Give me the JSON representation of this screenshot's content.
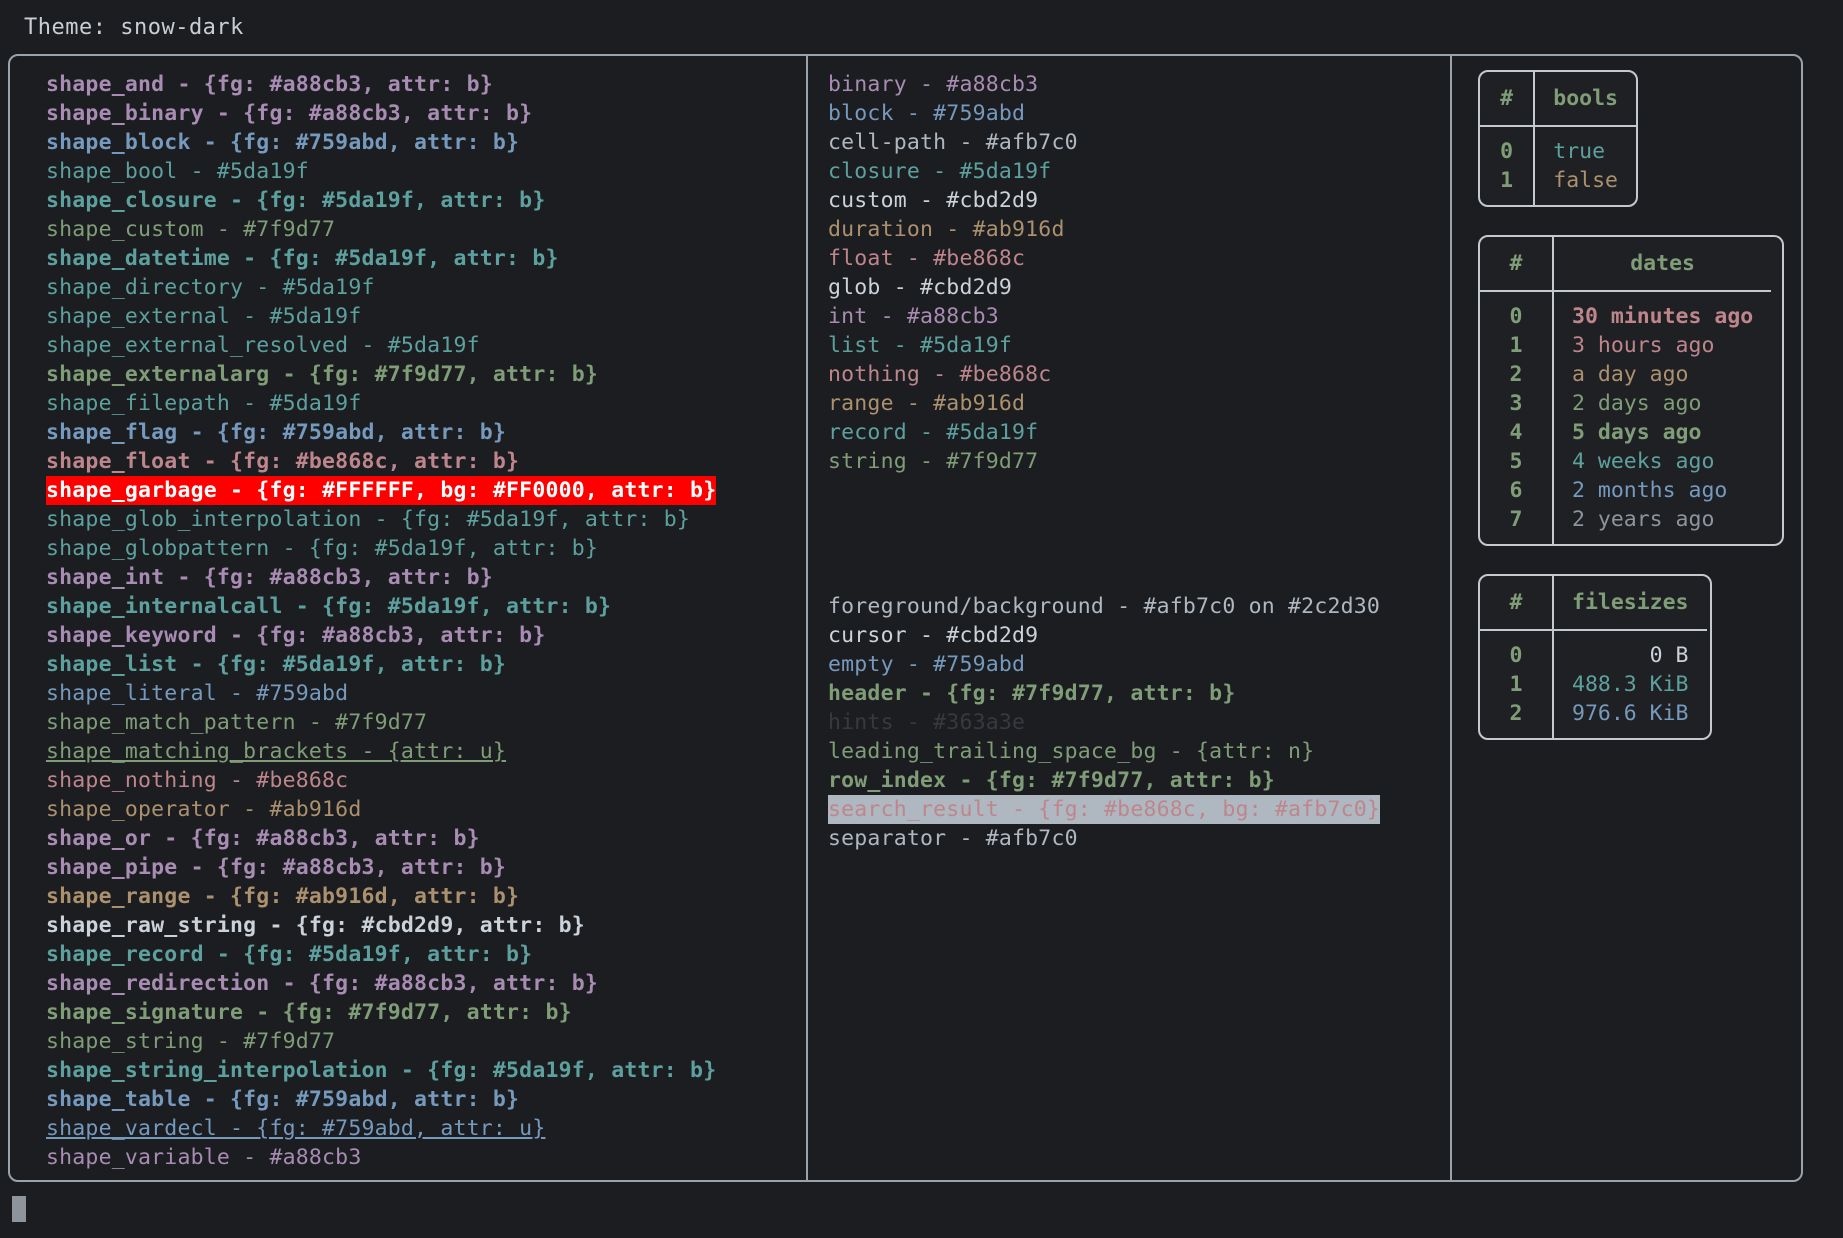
{
  "header": {
    "theme_label": "Theme: snow-dark"
  },
  "colors": {
    "purple": "#a88cb3",
    "blue": "#759abd",
    "teal": "#5da19f",
    "olive": "#7f9d77",
    "rose": "#be868c",
    "gold": "#ab916d",
    "white": "#cbd2d9",
    "grey": "#afb7c0",
    "dim": "#363a3e",
    "garbage_fg": "#FFFFFF",
    "garbage_bg": "#FF0000",
    "search_bg": "#afb7c0",
    "background": "#2c2d30"
  },
  "shapes_column": [
    {
      "text": "shape_and - {fg: #a88cb3, attr: b}",
      "color": "#a88cb3",
      "bold": true,
      "underline": false
    },
    {
      "text": "shape_binary - {fg: #a88cb3, attr: b}",
      "color": "#a88cb3",
      "bold": true,
      "underline": false
    },
    {
      "text": "shape_block - {fg: #759abd, attr: b}",
      "color": "#759abd",
      "bold": true,
      "underline": false
    },
    {
      "text": "shape_bool - #5da19f",
      "color": "#5da19f",
      "bold": false,
      "underline": false
    },
    {
      "text": "shape_closure - {fg: #5da19f, attr: b}",
      "color": "#5da19f",
      "bold": true,
      "underline": false
    },
    {
      "text": "shape_custom - #7f9d77",
      "color": "#7f9d77",
      "bold": false,
      "underline": false
    },
    {
      "text": "shape_datetime - {fg: #5da19f, attr: b}",
      "color": "#5da19f",
      "bold": true,
      "underline": false
    },
    {
      "text": "shape_directory - #5da19f",
      "color": "#5da19f",
      "bold": false,
      "underline": false
    },
    {
      "text": "shape_external - #5da19f",
      "color": "#5da19f",
      "bold": false,
      "underline": false
    },
    {
      "text": "shape_external_resolved - #5da19f",
      "color": "#5da19f",
      "bold": false,
      "underline": false
    },
    {
      "text": "shape_externalarg - {fg: #7f9d77, attr: b}",
      "color": "#7f9d77",
      "bold": true,
      "underline": false
    },
    {
      "text": "shape_filepath - #5da19f",
      "color": "#5da19f",
      "bold": false,
      "underline": false
    },
    {
      "text": "shape_flag - {fg: #759abd, attr: b}",
      "color": "#759abd",
      "bold": true,
      "underline": false
    },
    {
      "text": "shape_float - {fg: #be868c, attr: b}",
      "color": "#be868c",
      "bold": true,
      "underline": false
    },
    {
      "text": "shape_garbage - {fg: #FFFFFF, bg: #FF0000, attr: b}",
      "color": "#FFFFFF",
      "bg": "#FF0000",
      "bold": true,
      "underline": false
    },
    {
      "text": "shape_glob_interpolation - {fg: #5da19f, attr: b}",
      "color": "#5da19f",
      "bold": false,
      "underline": false
    },
    {
      "text": "shape_globpattern - {fg: #5da19f, attr: b}",
      "color": "#5da19f",
      "bold": false,
      "underline": false
    },
    {
      "text": "shape_int - {fg: #a88cb3, attr: b}",
      "color": "#a88cb3",
      "bold": true,
      "underline": false
    },
    {
      "text": "shape_internalcall - {fg: #5da19f, attr: b}",
      "color": "#5da19f",
      "bold": true,
      "underline": false
    },
    {
      "text": "shape_keyword - {fg: #a88cb3, attr: b}",
      "color": "#a88cb3",
      "bold": true,
      "underline": false
    },
    {
      "text": "shape_list - {fg: #5da19f, attr: b}",
      "color": "#5da19f",
      "bold": true,
      "underline": false
    },
    {
      "text": "shape_literal - #759abd",
      "color": "#759abd",
      "bold": false,
      "underline": false
    },
    {
      "text": "shape_match_pattern - #7f9d77",
      "color": "#7f9d77",
      "bold": false,
      "underline": false
    },
    {
      "text": "shape_matching_brackets - {attr: u}",
      "color": "#7f9d77",
      "bold": false,
      "underline": true
    },
    {
      "text": "shape_nothing - #be868c",
      "color": "#be868c",
      "bold": false,
      "underline": false
    },
    {
      "text": "shape_operator - #ab916d",
      "color": "#ab916d",
      "bold": false,
      "underline": false
    },
    {
      "text": "shape_or - {fg: #a88cb3, attr: b}",
      "color": "#a88cb3",
      "bold": true,
      "underline": false
    },
    {
      "text": "shape_pipe - {fg: #a88cb3, attr: b}",
      "color": "#a88cb3",
      "bold": true,
      "underline": false
    },
    {
      "text": "shape_range - {fg: #ab916d, attr: b}",
      "color": "#ab916d",
      "bold": true,
      "underline": false
    },
    {
      "text": "shape_raw_string - {fg: #cbd2d9, attr: b}",
      "color": "#cbd2d9",
      "bold": true,
      "underline": false
    },
    {
      "text": "shape_record - {fg: #5da19f, attr: b}",
      "color": "#5da19f",
      "bold": true,
      "underline": false
    },
    {
      "text": "shape_redirection - {fg: #a88cb3, attr: b}",
      "color": "#a88cb3",
      "bold": true,
      "underline": false
    },
    {
      "text": "shape_signature - {fg: #7f9d77, attr: b}",
      "color": "#7f9d77",
      "bold": true,
      "underline": false
    },
    {
      "text": "shape_string - #7f9d77",
      "color": "#7f9d77",
      "bold": false,
      "underline": false
    },
    {
      "text": "shape_string_interpolation - {fg: #5da19f, attr: b}",
      "color": "#5da19f",
      "bold": true,
      "underline": false
    },
    {
      "text": "shape_table - {fg: #759abd, attr: b}",
      "color": "#759abd",
      "bold": true,
      "underline": false
    },
    {
      "text": "shape_vardecl - {fg: #759abd, attr: u}",
      "color": "#759abd",
      "bold": false,
      "underline": true
    },
    {
      "text": "shape_variable - #a88cb3",
      "color": "#a88cb3",
      "bold": false,
      "underline": false
    }
  ],
  "types_column": [
    {
      "text": "binary - #a88cb3",
      "color": "#a88cb3",
      "bold": false,
      "underline": false
    },
    {
      "text": "block - #759abd",
      "color": "#759abd",
      "bold": false,
      "underline": false
    },
    {
      "text": "cell-path - #afb7c0",
      "color": "#afb7c0",
      "bold": false,
      "underline": false
    },
    {
      "text": "closure - #5da19f",
      "color": "#5da19f",
      "bold": false,
      "underline": false
    },
    {
      "text": "custom - #cbd2d9",
      "color": "#cbd2d9",
      "bold": false,
      "underline": false
    },
    {
      "text": "duration - #ab916d",
      "color": "#ab916d",
      "bold": false,
      "underline": false
    },
    {
      "text": "float - #be868c",
      "color": "#be868c",
      "bold": false,
      "underline": false
    },
    {
      "text": "glob - #cbd2d9",
      "color": "#cbd2d9",
      "bold": false,
      "underline": false
    },
    {
      "text": "int - #a88cb3",
      "color": "#a88cb3",
      "bold": false,
      "underline": false
    },
    {
      "text": "list - #5da19f",
      "color": "#5da19f",
      "bold": false,
      "underline": false
    },
    {
      "text": "nothing - #be868c",
      "color": "#be868c",
      "bold": false,
      "underline": false
    },
    {
      "text": "range - #ab916d",
      "color": "#ab916d",
      "bold": false,
      "underline": false
    },
    {
      "text": "record - #5da19f",
      "color": "#5da19f",
      "bold": false,
      "underline": false
    },
    {
      "text": "string - #7f9d77",
      "color": "#7f9d77",
      "bold": false,
      "underline": false
    }
  ],
  "ui_column": [
    {
      "text": "foreground/background - #afb7c0 on #2c2d30",
      "color": "#afb7c0",
      "bold": false,
      "underline": false
    },
    {
      "text": "cursor - #cbd2d9",
      "color": "#cbd2d9",
      "bold": false,
      "underline": false
    },
    {
      "text": "empty - #759abd",
      "color": "#759abd",
      "bold": false,
      "underline": false
    },
    {
      "text": "header - {fg: #7f9d77, attr: b}",
      "color": "#7f9d77",
      "bold": true,
      "underline": false
    },
    {
      "text": "hints - #363a3e",
      "color": "#363a3e",
      "bold": false,
      "underline": false
    },
    {
      "text": "leading_trailing_space_bg - {attr: n}",
      "color": "#7f9d77",
      "bold": false,
      "underline": false
    },
    {
      "text": "row_index - {fg: #7f9d77, attr: b}",
      "color": "#7f9d77",
      "bold": true,
      "underline": false
    },
    {
      "text": "search_result - {fg: #be868c, bg: #afb7c0}",
      "color": "#be868c",
      "bg": "#afb7c0",
      "bold": false,
      "underline": false
    },
    {
      "text": "separator - #afb7c0",
      "color": "#afb7c0",
      "bold": false,
      "underline": false
    }
  ],
  "tables": {
    "bools": {
      "index_header": "#",
      "title": "bools",
      "rows": [
        {
          "index": "0",
          "value": "true",
          "color": "#5da19f",
          "bold": false
        },
        {
          "index": "1",
          "value": "false",
          "color": "#ab916d",
          "bold": false
        }
      ]
    },
    "dates": {
      "index_header": "#",
      "title": "dates",
      "rows": [
        {
          "index": "0",
          "value": "30 minutes ago",
          "color": "#be868c",
          "bold": true
        },
        {
          "index": "1",
          "value": "3 hours ago",
          "color": "#be868c",
          "bold": false
        },
        {
          "index": "2",
          "value": "a day ago",
          "color": "#ab916d",
          "bold": false
        },
        {
          "index": "3",
          "value": "2 days ago",
          "color": "#7f9d77",
          "bold": false
        },
        {
          "index": "4",
          "value": "5 days ago",
          "color": "#7f9d77",
          "bold": true
        },
        {
          "index": "5",
          "value": "4 weeks ago",
          "color": "#5da19f",
          "bold": false
        },
        {
          "index": "6",
          "value": "2 months ago",
          "color": "#759abd",
          "bold": false
        },
        {
          "index": "7",
          "value": "2 years ago",
          "color": "#8d949c",
          "bold": false
        }
      ]
    },
    "filesizes": {
      "index_header": "#",
      "title": "filesizes",
      "rows": [
        {
          "index": "0",
          "value": "0 B",
          "color": "#cbd2d9",
          "bold": false
        },
        {
          "index": "1",
          "value": "488.3 KiB",
          "color": "#5da19f",
          "bold": false
        },
        {
          "index": "2",
          "value": "976.6 KiB",
          "color": "#759abd",
          "bold": false
        }
      ]
    }
  }
}
